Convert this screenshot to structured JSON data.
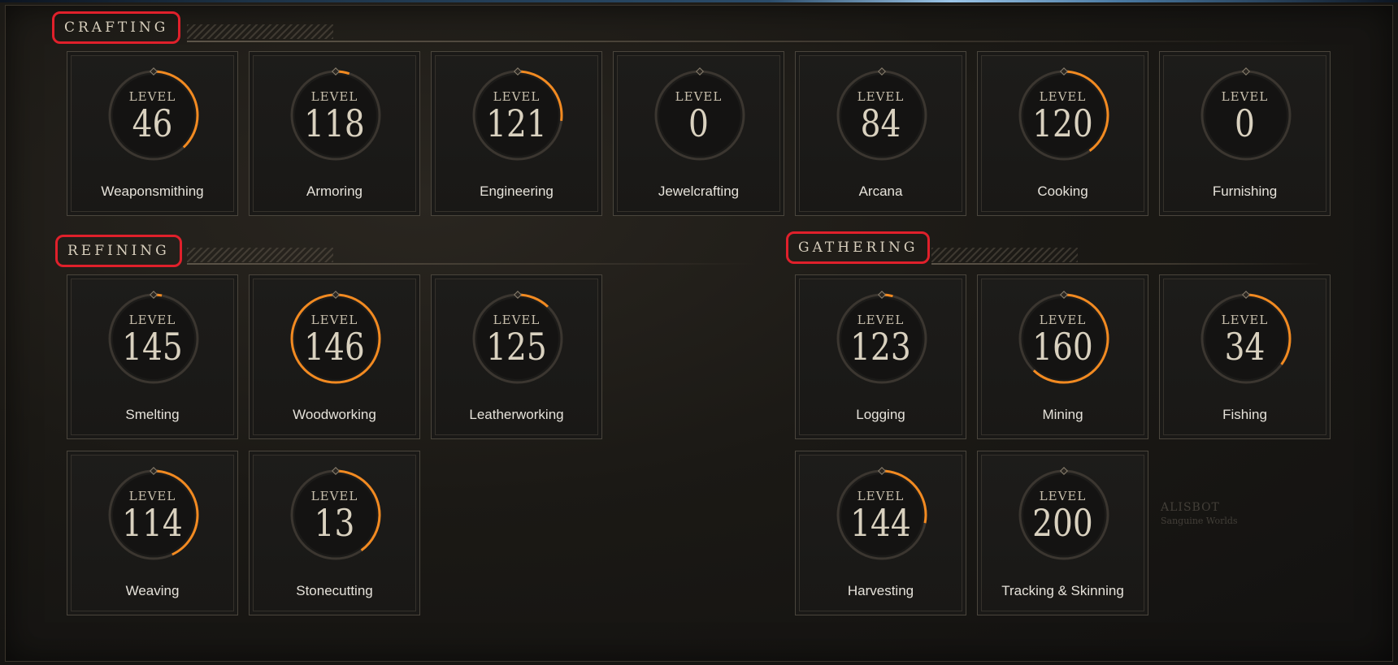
{
  "sections": {
    "crafting": {
      "title": "CRAFTING",
      "skills": [
        {
          "name": "Weaponsmithing",
          "level_label": "LEVEL",
          "level": "46",
          "progress": 0.38
        },
        {
          "name": "Armoring",
          "level_label": "LEVEL",
          "level": "118",
          "progress": 0.05
        },
        {
          "name": "Engineering",
          "level_label": "LEVEL",
          "level": "121",
          "progress": 0.27
        },
        {
          "name": "Jewelcrafting",
          "level_label": "LEVEL",
          "level": "0",
          "progress": 0.0
        },
        {
          "name": "Arcana",
          "level_label": "LEVEL",
          "level": "84",
          "progress": 0.0
        },
        {
          "name": "Cooking",
          "level_label": "LEVEL",
          "level": "120",
          "progress": 0.4
        },
        {
          "name": "Furnishing",
          "level_label": "LEVEL",
          "level": "0",
          "progress": 0.0
        }
      ]
    },
    "refining": {
      "title": "REFINING",
      "skills": [
        {
          "name": "Smelting",
          "level_label": "LEVEL",
          "level": "145",
          "progress": 0.03
        },
        {
          "name": "Woodworking",
          "level_label": "LEVEL",
          "level": "146",
          "progress": 1.0
        },
        {
          "name": "Leatherworking",
          "level_label": "LEVEL",
          "level": "125",
          "progress": 0.12
        },
        {
          "name": "Weaving",
          "level_label": "LEVEL",
          "level": "114",
          "progress": 0.43
        },
        {
          "name": "Stonecutting",
          "level_label": "LEVEL",
          "level": "13",
          "progress": 0.4
        }
      ]
    },
    "gathering": {
      "title": "GATHERING",
      "skills": [
        {
          "name": "Logging",
          "level_label": "LEVEL",
          "level": "123",
          "progress": 0.04
        },
        {
          "name": "Mining",
          "level_label": "LEVEL",
          "level": "160",
          "progress": 0.62
        },
        {
          "name": "Fishing",
          "level_label": "LEVEL",
          "level": "34",
          "progress": 0.35
        },
        {
          "name": "Harvesting",
          "level_label": "LEVEL",
          "level": "144",
          "progress": 0.28
        },
        {
          "name": "Tracking & Skinning",
          "level_label": "LEVEL",
          "level": "200",
          "progress": 0.0
        }
      ]
    }
  },
  "watermark": {
    "line1": "ALISBOT",
    "line2": "Sanguine Worlds"
  },
  "colors": {
    "progress": "#f28a21",
    "ring": "#3b3630",
    "section_highlight": "#e0202b"
  }
}
